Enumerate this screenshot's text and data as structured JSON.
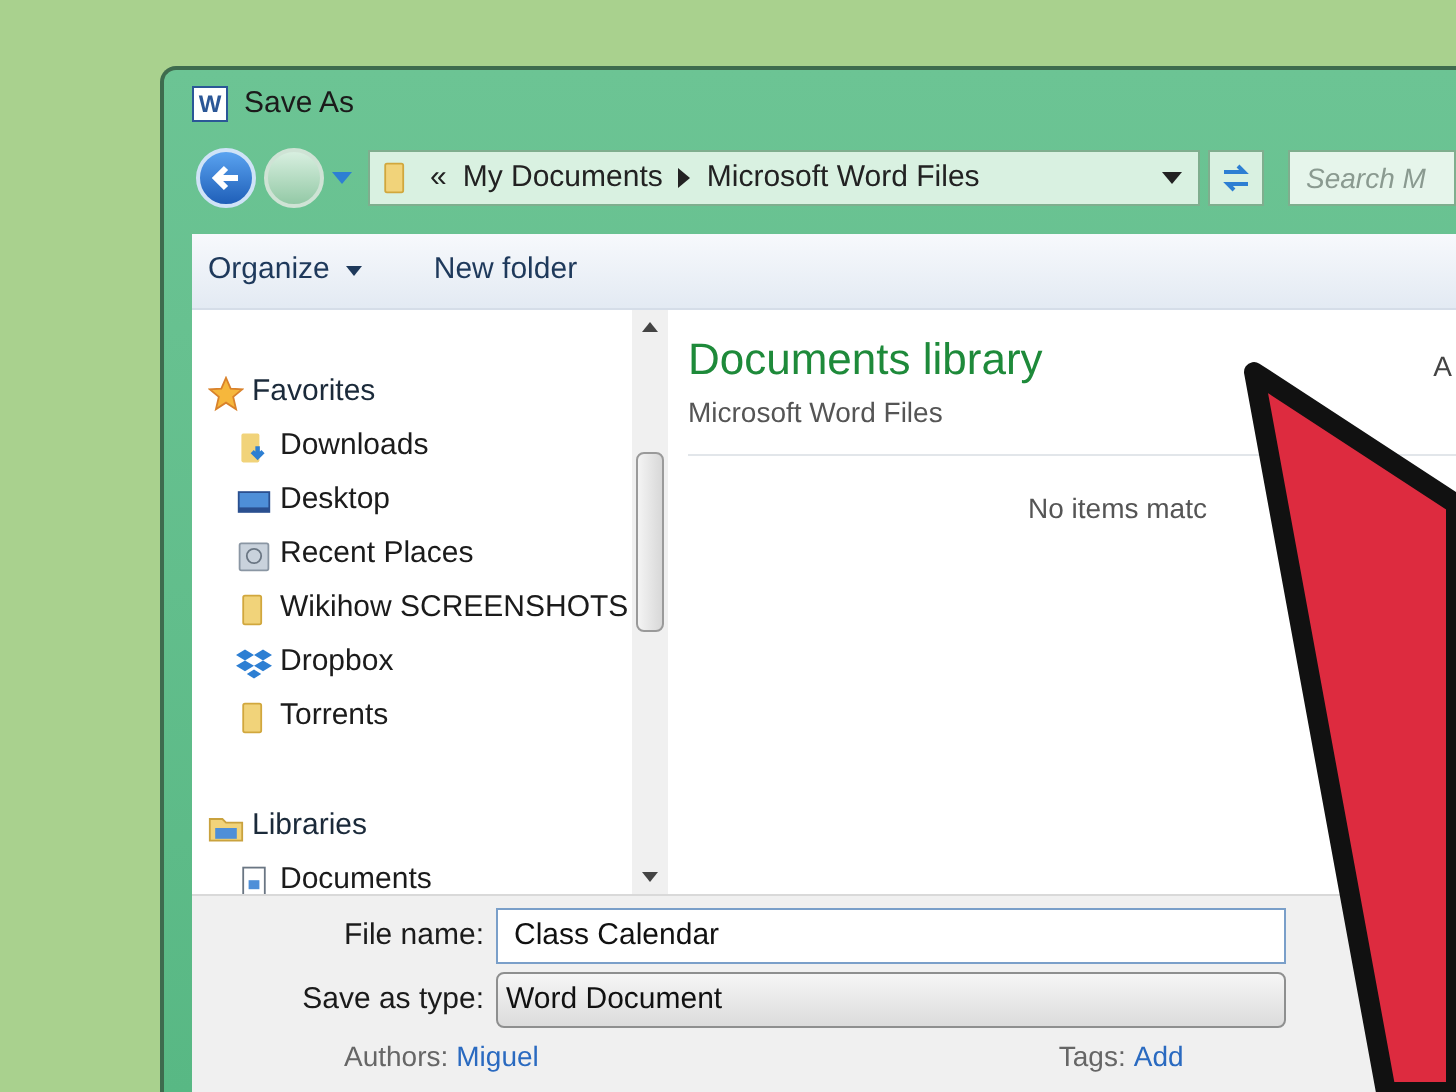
{
  "window": {
    "app_icon": "W",
    "title": "Save As"
  },
  "address_bar": {
    "overflow": "«",
    "crumbs": [
      "My Documents",
      "Microsoft Word Files"
    ]
  },
  "search": {
    "placeholder": "Search M"
  },
  "toolbar": [
    {
      "label": "Organize",
      "kind": "menu"
    },
    {
      "label": "New folder",
      "kind": "button"
    }
  ],
  "nav_pane": {
    "groups": [
      {
        "label": "Favorites",
        "kind": "star",
        "children": [
          {
            "label": "Downloads",
            "kind": "download"
          },
          {
            "label": "Desktop",
            "kind": "desktop"
          },
          {
            "label": "Recent Places",
            "kind": "recent"
          },
          {
            "label": "Wikihow SCREENSHOTS",
            "kind": "folder"
          },
          {
            "label": "Dropbox",
            "kind": "dropbox"
          },
          {
            "label": "Torrents",
            "kind": "folder"
          }
        ]
      },
      {
        "label": "Libraries",
        "kind": "library",
        "children": [
          {
            "label": "Documents",
            "kind": "document"
          }
        ]
      }
    ]
  },
  "content": {
    "title": "Documents library",
    "subtitle": "Microsoft Word Files",
    "arrange_label": "A",
    "empty_message": "No items matc"
  },
  "form": {
    "fields": [
      {
        "label": "File name:",
        "value": "Class Calendar",
        "kind": "text"
      },
      {
        "label": "Save as type:",
        "value": "Word Document",
        "kind": "select"
      }
    ],
    "meta": [
      {
        "label": "Authors:",
        "value": "Miguel"
      },
      {
        "label": "Tags:",
        "value": "Add"
      }
    ]
  }
}
